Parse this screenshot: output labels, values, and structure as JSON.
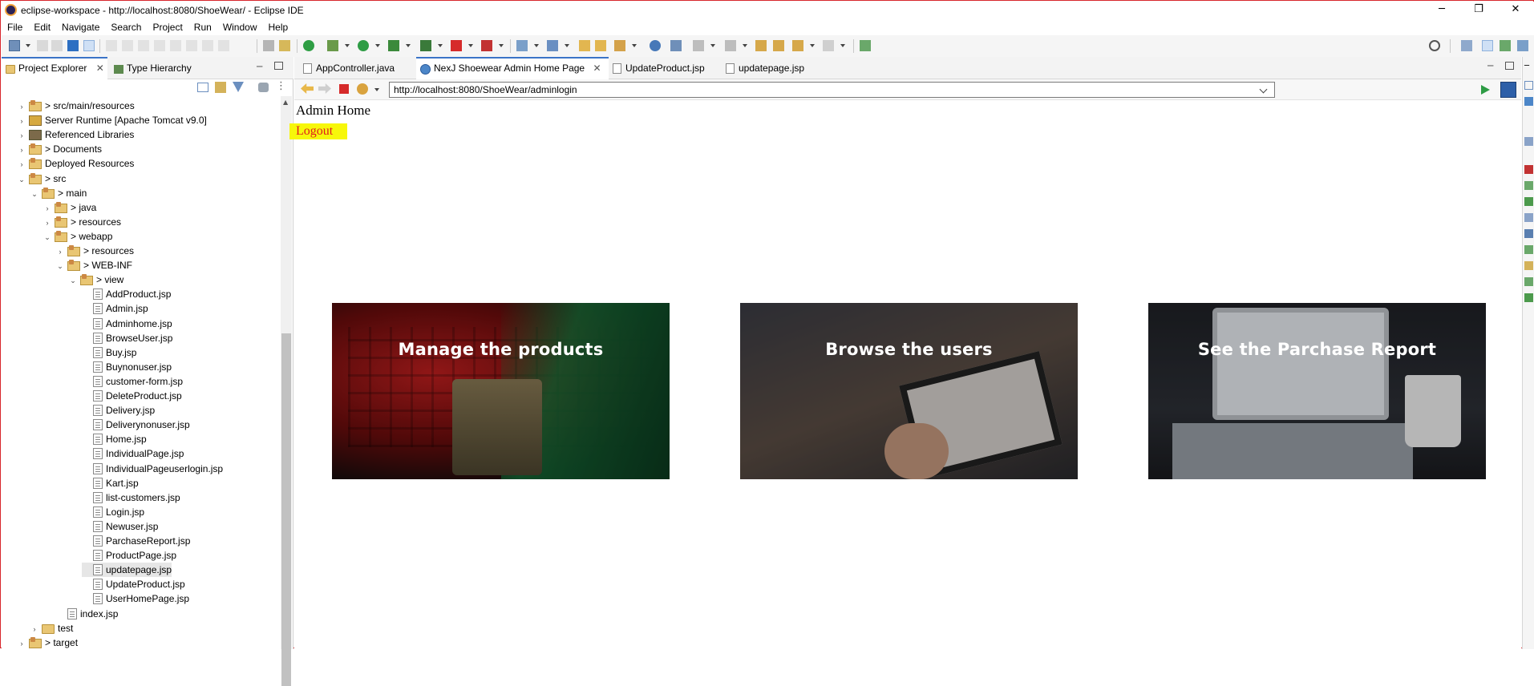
{
  "window": {
    "title": "eclipse-workspace - http://localhost:8080/ShoeWear/ - Eclipse IDE",
    "controls": [
      "─",
      "❐",
      "✕"
    ]
  },
  "menu": [
    "File",
    "Edit",
    "Navigate",
    "Search",
    "Project",
    "Run",
    "Window",
    "Help"
  ],
  "left_panel": {
    "tabs": [
      "Project Explorer",
      "Type Hierarchy"
    ],
    "tree": [
      {
        "label": "> src/main/resources",
        "icon": "pkgfolder",
        "level": 2,
        "toggle": "›"
      },
      {
        "label": "Server Runtime [Apache Tomcat v9.0]",
        "icon": "server",
        "level": 2,
        "toggle": "›"
      },
      {
        "label": "Referenced Libraries",
        "icon": "lib",
        "level": 2,
        "toggle": "›"
      },
      {
        "label": "> Documents",
        "icon": "pkgfolder",
        "level": 2,
        "toggle": "›"
      },
      {
        "label": "Deployed Resources",
        "icon": "pkgfolder",
        "level": 2,
        "toggle": "›"
      },
      {
        "label": "> src",
        "icon": "pkgfolder",
        "level": 2,
        "toggle": "⌄"
      },
      {
        "label": "> main",
        "icon": "pkgfolder",
        "level": 3,
        "toggle": "⌄"
      },
      {
        "label": "> java",
        "icon": "pkgfolder",
        "level": 4,
        "toggle": "›"
      },
      {
        "label": "> resources",
        "icon": "pkgfolder",
        "level": 4,
        "toggle": "›"
      },
      {
        "label": "> webapp",
        "icon": "pkgfolder",
        "level": 4,
        "toggle": "⌄"
      },
      {
        "label": "> resources",
        "icon": "pkgfolder",
        "level": 5,
        "toggle": "›"
      },
      {
        "label": "> WEB-INF",
        "icon": "pkgfolder",
        "level": 5,
        "toggle": "⌄"
      },
      {
        "label": "> view",
        "icon": "pkgfolder",
        "level": 6,
        "toggle": "⌄"
      },
      {
        "label": "AddProduct.jsp",
        "icon": "jsp",
        "level": 7,
        "toggle": ""
      },
      {
        "label": "Admin.jsp",
        "icon": "jsp",
        "level": 7,
        "toggle": ""
      },
      {
        "label": "Adminhome.jsp",
        "icon": "jsp",
        "level": 7,
        "toggle": ""
      },
      {
        "label": "BrowseUser.jsp",
        "icon": "jsp",
        "level": 7,
        "toggle": ""
      },
      {
        "label": "Buy.jsp",
        "icon": "jsp",
        "level": 7,
        "toggle": ""
      },
      {
        "label": "Buynonuser.jsp",
        "icon": "jsp",
        "level": 7,
        "toggle": ""
      },
      {
        "label": "customer-form.jsp",
        "icon": "jsp",
        "level": 7,
        "toggle": ""
      },
      {
        "label": "DeleteProduct.jsp",
        "icon": "jsp",
        "level": 7,
        "toggle": ""
      },
      {
        "label": "Delivery.jsp",
        "icon": "jsp",
        "level": 7,
        "toggle": ""
      },
      {
        "label": "Deliverynonuser.jsp",
        "icon": "jsp",
        "level": 7,
        "toggle": ""
      },
      {
        "label": "Home.jsp",
        "icon": "jsp",
        "level": 7,
        "toggle": ""
      },
      {
        "label": "IndividualPage.jsp",
        "icon": "jsp",
        "level": 7,
        "toggle": ""
      },
      {
        "label": "IndividualPageuserlogin.jsp",
        "icon": "jsp",
        "level": 7,
        "toggle": ""
      },
      {
        "label": "Kart.jsp",
        "icon": "jsp",
        "level": 7,
        "toggle": ""
      },
      {
        "label": "list-customers.jsp",
        "icon": "jsp",
        "level": 7,
        "toggle": ""
      },
      {
        "label": "Login.jsp",
        "icon": "jsp",
        "level": 7,
        "toggle": ""
      },
      {
        "label": "Newuser.jsp",
        "icon": "jsp",
        "level": 7,
        "toggle": ""
      },
      {
        "label": "ParchaseReport.jsp",
        "icon": "jsp",
        "level": 7,
        "toggle": ""
      },
      {
        "label": "ProductPage.jsp",
        "icon": "jsp",
        "level": 7,
        "toggle": ""
      },
      {
        "label": "updatepage.jsp",
        "icon": "jsp",
        "level": 7,
        "toggle": "",
        "selected": true
      },
      {
        "label": "UpdateProduct.jsp",
        "icon": "jsp",
        "level": 7,
        "toggle": ""
      },
      {
        "label": "UserHomePage.jsp",
        "icon": "jsp",
        "level": 7,
        "toggle": ""
      },
      {
        "label": "index.jsp",
        "icon": "jsp",
        "level": 5,
        "toggle": ""
      },
      {
        "label": "test",
        "icon": "folder",
        "level": 3,
        "toggle": "›"
      },
      {
        "label": "> target",
        "icon": "pkgfolder",
        "level": 2,
        "toggle": "›"
      }
    ]
  },
  "editor": {
    "tabs": [
      {
        "label": "AppController.java",
        "active": false
      },
      {
        "label": "NexJ Shoewear Admin Home Page",
        "active": true
      },
      {
        "label": "UpdateProduct.jsp",
        "active": false
      },
      {
        "label": "updatepage.jsp",
        "active": false
      }
    ],
    "url": "http://localhost:8080/ShoeWear/adminlogin"
  },
  "page": {
    "heading": "Admin Home",
    "logout": "Logout",
    "cards": [
      "Manage the products",
      "Browse the users",
      "See the Parchase Report"
    ]
  }
}
